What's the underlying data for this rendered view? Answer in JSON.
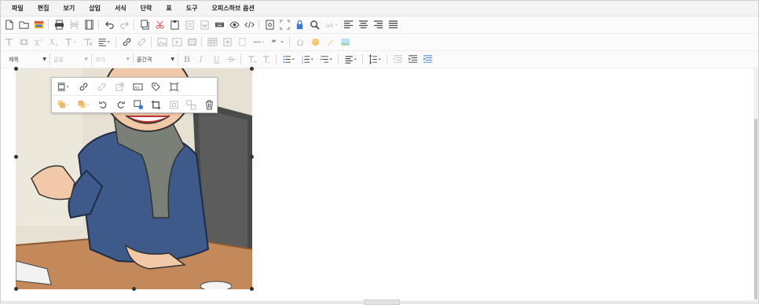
{
  "menubar": {
    "items": [
      "파일",
      "편집",
      "보기",
      "삽입",
      "서식",
      "단락",
      "표",
      "도구",
      "오피스하브 옵션"
    ]
  },
  "format_toolbar": {
    "heading_select": "제목",
    "font_select": "글꼴",
    "size_select": "크기",
    "line_height_select": "줄간격"
  },
  "colors": {
    "menubar_bg": "#f4f4f4",
    "toolbar_bg": "#fbfbfb",
    "accent_blue": "#3a7bd5",
    "accent_red": "#d9534f",
    "disabled_gray": "#c0c0c0"
  }
}
